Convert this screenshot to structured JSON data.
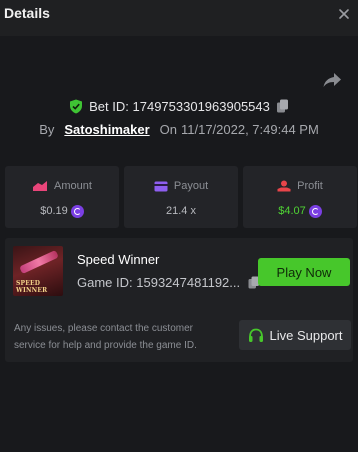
{
  "header": {
    "title": "Details",
    "close_icon": "close-icon"
  },
  "bet": {
    "verified_icon": "shield-check-icon",
    "bet_id_label": "Bet ID:",
    "bet_id": "1749753301963905543",
    "by_label": "By",
    "username": "Satoshimaker",
    "on_label": "On",
    "datetime": "11/17/2022, 7:49:44 PM",
    "share_icon": "share-icon"
  },
  "stats": [
    {
      "label": "Amount",
      "value": "$0.19",
      "icon": "wallet-icon",
      "icon_color": "#e9457a",
      "value_color": "#b7b9be",
      "coin": true
    },
    {
      "label": "Payout",
      "value": "21.4 x",
      "icon": "card-icon",
      "icon_color": "#8e5ef0",
      "value_color": "#b7b9be",
      "coin": false
    },
    {
      "label": "Profit",
      "value": "$4.07",
      "icon": "profit-icon",
      "icon_color": "#e9454a",
      "value_color": "#4fd334",
      "coin": true
    }
  ],
  "game": {
    "name": "Speed Winner",
    "game_id_label": "Game ID:",
    "game_id": "1593247481192...",
    "thumb_line1": "SPEED",
    "thumb_line2": "WINNER",
    "play_label": "Play Now",
    "play_color": "#47c72b"
  },
  "support": {
    "note": "Any issues, please contact the customer service for help and provide the game ID.",
    "button_label": "Live Support",
    "icon": "headset-icon",
    "icon_color": "#47c72b"
  }
}
